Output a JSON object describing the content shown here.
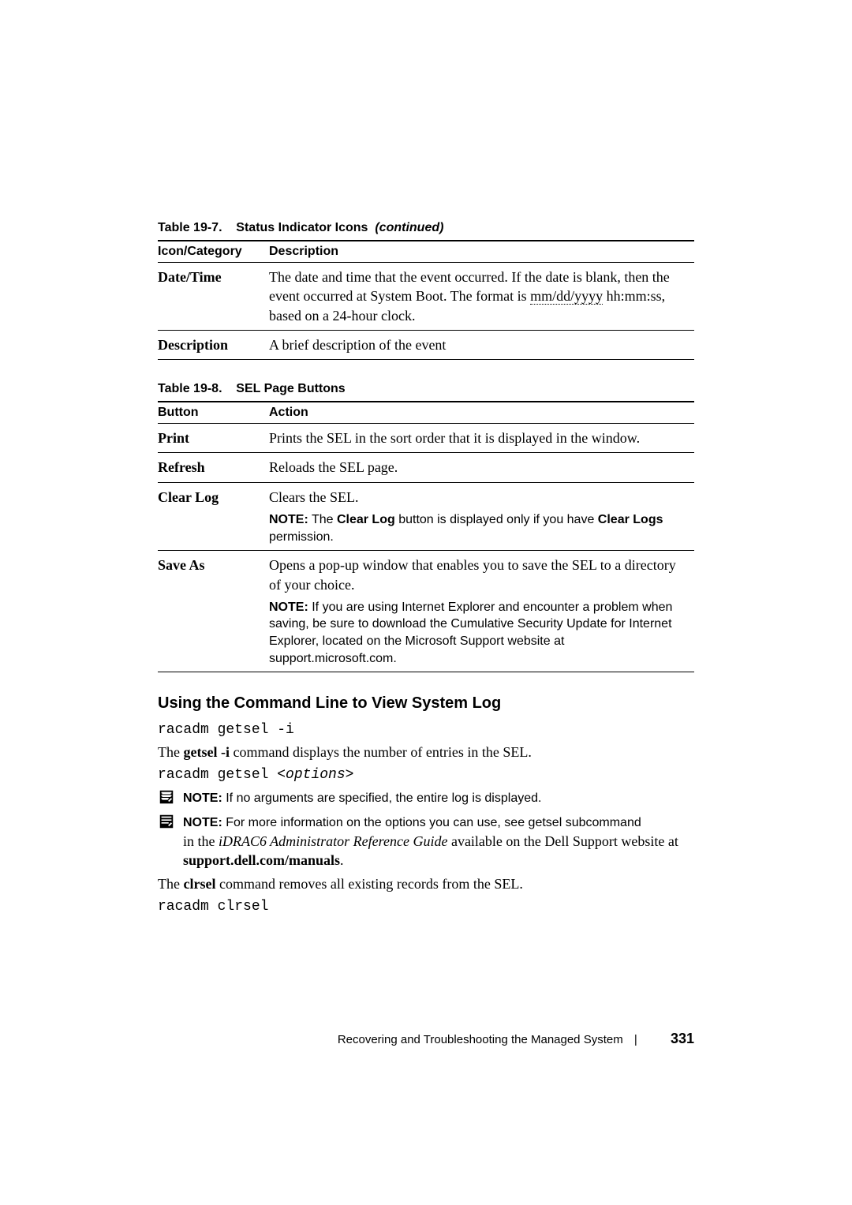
{
  "table19_7": {
    "caption_prefix": "Table 19-7.",
    "caption_title": "Status Indicator Icons",
    "caption_suffix": "(continued)",
    "header_col1": "Icon/Category",
    "header_col2": "Description",
    "rows": [
      {
        "col1": "Date/Time",
        "col2_pre": "The date and time that the event occurred. If the date is blank, then the event occurred at System Boot. The format is ",
        "col2_dotted": "mm/dd/yyyy",
        "col2_post": " hh:mm:ss, based on a 24-hour clock."
      },
      {
        "col1": "Description",
        "col2_text": "A brief description of the event"
      }
    ]
  },
  "table19_8": {
    "caption_prefix": "Table 19-8.",
    "caption_title": "SEL Page Buttons",
    "header_col1": "Button",
    "header_col2": "Action",
    "rows": {
      "print": {
        "label": "Print",
        "text": "Prints the SEL in the sort order that it is displayed in the window."
      },
      "refresh": {
        "label": "Refresh",
        "text": "Reloads the SEL page."
      },
      "clearlog": {
        "label": "Clear Log",
        "text": "Clears the SEL.",
        "note_label": "NOTE:",
        "note_pre": " The ",
        "note_bold1": "Clear Log",
        "note_mid": " button is displayed only if you have ",
        "note_bold2": "Clear Logs",
        "note_post": " permission."
      },
      "saveas": {
        "label": "Save As",
        "text": "Opens a pop-up window that enables you to save the SEL to a directory of your choice.",
        "note_label": "NOTE:",
        "note_text": " If you are using Internet Explorer and encounter a problem when saving, be sure to download the Cumulative Security Update for Internet Explorer, located on the Microsoft Support website at support.microsoft.com."
      }
    }
  },
  "heading": "Using the Command Line to View System Log",
  "cmd1": "racadm getsel -i",
  "body1_pre": "The ",
  "body1_bold": "getsel -i",
  "body1_post": " command displays the number of entries in the SEL.",
  "cmd2_pre": "racadm getsel ",
  "cmd2_ital": "<options>",
  "note1_label": "NOTE:",
  "note1_text": " If no arguments are specified, the entire log is displayed.",
  "note2_label": "NOTE:",
  "note2_sans": " For more information on the options you can use, see getsel subcommand",
  "note2_serif_pre": "in the ",
  "note2_serif_ital": "iDRAC6 Administrator Reference Guide",
  "note2_serif_mid": " available on the Dell Support website at ",
  "note2_serif_bold": "support.dell.com/manuals",
  "note2_serif_end": ".",
  "body2_pre": "The ",
  "body2_bold": "clrsel",
  "body2_post": " command removes all existing records from the SEL.",
  "cmd3": "racadm clrsel",
  "footer_text": "Recovering and Troubleshooting the Managed System",
  "footer_page": "331"
}
